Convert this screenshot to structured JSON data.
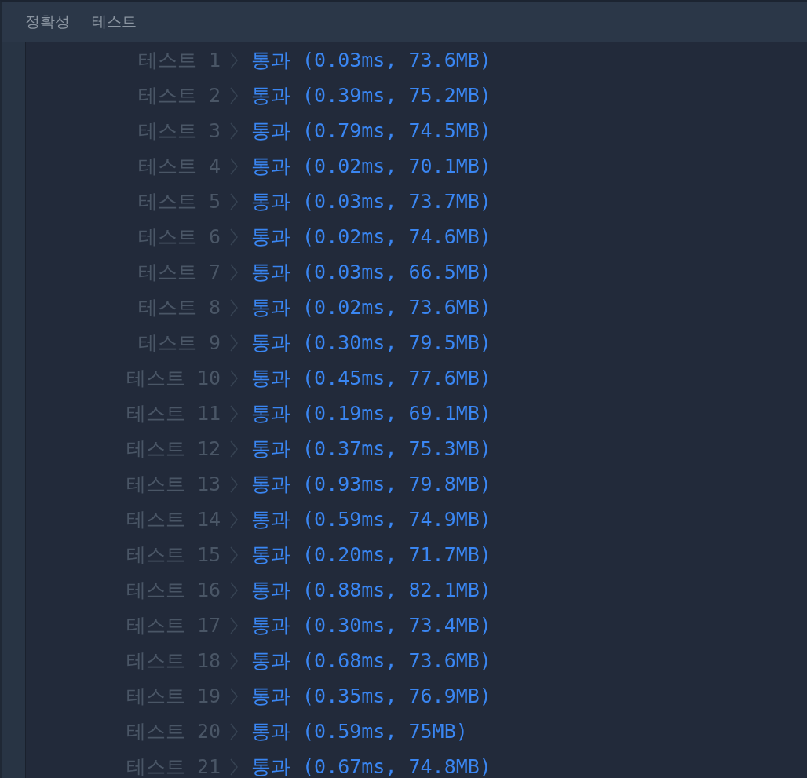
{
  "heading": {
    "category": "정확성",
    "title": "테스트"
  },
  "results": [
    {
      "label": "테스트 1",
      "result": "통과 (0.03ms, 73.6MB)"
    },
    {
      "label": "테스트 2",
      "result": "통과 (0.39ms, 75.2MB)"
    },
    {
      "label": "테스트 3",
      "result": "통과 (0.79ms, 74.5MB)"
    },
    {
      "label": "테스트 4",
      "result": "통과 (0.02ms, 70.1MB)"
    },
    {
      "label": "테스트 5",
      "result": "통과 (0.03ms, 73.7MB)"
    },
    {
      "label": "테스트 6",
      "result": "통과 (0.02ms, 74.6MB)"
    },
    {
      "label": "테스트 7",
      "result": "통과 (0.03ms, 66.5MB)"
    },
    {
      "label": "테스트 8",
      "result": "통과 (0.02ms, 73.6MB)"
    },
    {
      "label": "테스트 9",
      "result": "통과 (0.30ms, 79.5MB)"
    },
    {
      "label": "테스트 10",
      "result": "통과 (0.45ms, 77.6MB)"
    },
    {
      "label": "테스트 11",
      "result": "통과 (0.19ms, 69.1MB)"
    },
    {
      "label": "테스트 12",
      "result": "통과 (0.37ms, 75.3MB)"
    },
    {
      "label": "테스트 13",
      "result": "통과 (0.93ms, 79.8MB)"
    },
    {
      "label": "테스트 14",
      "result": "통과 (0.59ms, 74.9MB)"
    },
    {
      "label": "테스트 15",
      "result": "통과 (0.20ms, 71.7MB)"
    },
    {
      "label": "테스트 16",
      "result": "통과 (0.88ms, 82.1MB)"
    },
    {
      "label": "테스트 17",
      "result": "통과 (0.30ms, 73.4MB)"
    },
    {
      "label": "테스트 18",
      "result": "통과 (0.68ms, 73.6MB)"
    },
    {
      "label": "테스트 19",
      "result": "통과 (0.35ms, 76.9MB)"
    },
    {
      "label": "테스트 20",
      "result": "통과 (0.59ms, 75MB)"
    },
    {
      "label": "테스트 21",
      "result": "통과 (0.67ms, 74.8MB)"
    }
  ]
}
